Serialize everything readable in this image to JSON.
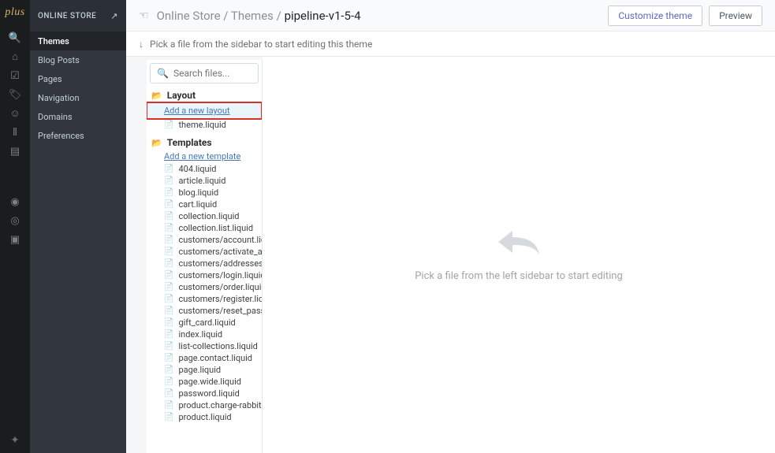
{
  "logo": "plus",
  "sidebar": {
    "title": "ONLINE STORE",
    "items": [
      {
        "label": "Themes"
      },
      {
        "label": "Blog Posts"
      },
      {
        "label": "Pages"
      },
      {
        "label": "Navigation"
      },
      {
        "label": "Domains"
      },
      {
        "label": "Preferences"
      }
    ]
  },
  "breadcrumb": {
    "seg1": "Online Store",
    "seg2": "Themes",
    "current": "pipeline-v1-5-4",
    "sep": " / "
  },
  "buttons": {
    "customize": "Customize theme",
    "preview": "Preview"
  },
  "hint": "Pick a file from the sidebar to start editing this theme",
  "search": {
    "placeholder": "Search files..."
  },
  "folders": {
    "layout": {
      "label": "Layout",
      "add": "Add a new layout",
      "files": [
        "theme.liquid"
      ]
    },
    "templates": {
      "label": "Templates",
      "add": "Add a new template",
      "files": [
        "404.liquid",
        "article.liquid",
        "blog.liquid",
        "cart.liquid",
        "collection.liquid",
        "collection.list.liquid",
        "customers/account.liquid",
        "customers/activate_accoun",
        "customers/addresses.liqui",
        "customers/login.liquid",
        "customers/order.liquid",
        "customers/register.liquid",
        "customers/reset_password",
        "gift_card.liquid",
        "index.liquid",
        "list-collections.liquid",
        "page.contact.liquid",
        "page.liquid",
        "page.wide.liquid",
        "password.liquid",
        "product.charge-rabbit.liqu",
        "product.liquid"
      ]
    }
  },
  "editor": {
    "placeholder": "Pick a file from the left sidebar to start editing"
  }
}
